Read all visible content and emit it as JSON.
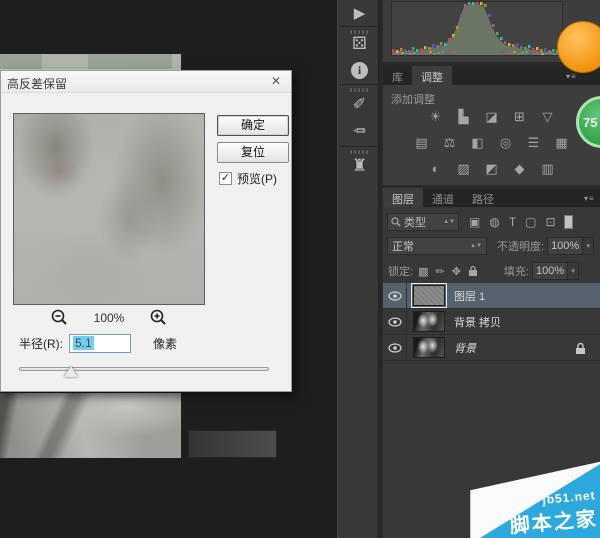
{
  "dialog": {
    "title": "高反差保留",
    "close_glyph": "✕",
    "ok_label": "确定",
    "reset_label": "复位",
    "check_glyph": "✓",
    "preview_label": "预览(P)",
    "zoom_level": "100%",
    "radius_label": "半径(R):",
    "radius_value": "5.1",
    "radius_unit": "像素"
  },
  "dock": {
    "icons": [
      {
        "name": "actions-play-icon",
        "glyph": "▶"
      },
      {
        "name": "styles-icon",
        "glyph": "⚄"
      },
      {
        "name": "info-icon",
        "glyph": "i"
      },
      {
        "name": "brush-presets-icon",
        "glyph": "✐"
      },
      {
        "name": "brush-settings-icon",
        "glyph": "✏"
      },
      {
        "name": "clone-source-icon",
        "glyph": "♜"
      }
    ]
  },
  "adjustments": {
    "tabs": [
      {
        "label": "库"
      },
      {
        "label": "调整"
      }
    ],
    "menu_glyph": "▾≡",
    "add_label": "添加调整",
    "row1": [
      {
        "name": "brightness-contrast-icon",
        "glyph": "☀"
      },
      {
        "name": "levels-icon",
        "glyph": "▙"
      },
      {
        "name": "curves-icon",
        "glyph": "◪"
      },
      {
        "name": "exposure-icon",
        "glyph": "⊞"
      },
      {
        "name": "vibrance-icon",
        "glyph": "▽"
      }
    ],
    "row2": [
      {
        "name": "hue-saturation-icon",
        "glyph": "▤"
      },
      {
        "name": "color-balance-icon",
        "glyph": "⚖"
      },
      {
        "name": "black-white-icon",
        "glyph": "◧"
      },
      {
        "name": "photo-filter-icon",
        "glyph": "◎"
      },
      {
        "name": "channel-mixer-icon",
        "glyph": "☰"
      },
      {
        "name": "color-lookup-icon",
        "glyph": "▦"
      }
    ],
    "row3": [
      {
        "name": "invert-icon",
        "glyph": "◐"
      },
      {
        "name": "posterize-icon",
        "glyph": "▨"
      },
      {
        "name": "threshold-icon",
        "glyph": "◩"
      },
      {
        "name": "gradient-map-icon",
        "glyph": "◆"
      },
      {
        "name": "selective-color-icon",
        "glyph": "▥"
      }
    ]
  },
  "layers_panel": {
    "tabs": [
      {
        "label": "图层"
      },
      {
        "label": "通道"
      },
      {
        "label": "路径"
      }
    ],
    "menu_glyph": "▾≡",
    "kind_label": "类型",
    "dd_arrows": "▲▼",
    "filter_icons": [
      {
        "name": "filter-pixel-layers-icon",
        "glyph": "▣"
      },
      {
        "name": "filter-adjustment-layers-icon",
        "glyph": "◍"
      },
      {
        "name": "filter-type-layers-icon",
        "glyph": "T"
      },
      {
        "name": "filter-shape-layers-icon",
        "glyph": "▢"
      },
      {
        "name": "filter-smart-objects-icon",
        "glyph": "⊡"
      }
    ],
    "blend_mode": "正常",
    "opacity_label": "不透明度:",
    "opacity_value": "100%",
    "lock_label": "锁定:",
    "lock_icons": [
      {
        "name": "lock-transparency-icon",
        "glyph": "▩"
      },
      {
        "name": "lock-image-icon",
        "glyph": "✏"
      },
      {
        "name": "lock-position-icon",
        "glyph": "✥"
      },
      {
        "name": "lock-all-icon",
        "glyph": "⚿"
      }
    ],
    "fill_label": "填充:",
    "fill_value": "100%",
    "layers": [
      {
        "label": "图层 1"
      },
      {
        "label": "背景 拷贝"
      },
      {
        "label": "背景"
      }
    ]
  },
  "badges": {
    "green_label": "75"
  },
  "watermark": {
    "line1": "jb51.net",
    "line2": "脚本之家"
  },
  "colors": {
    "watermark_blue": "#2ea9dd",
    "selected_row": "#55626d",
    "badge_orange": "#f2920f",
    "badge_green": "#2f9e47",
    "radius_selection_blue": "#6fcdee"
  }
}
